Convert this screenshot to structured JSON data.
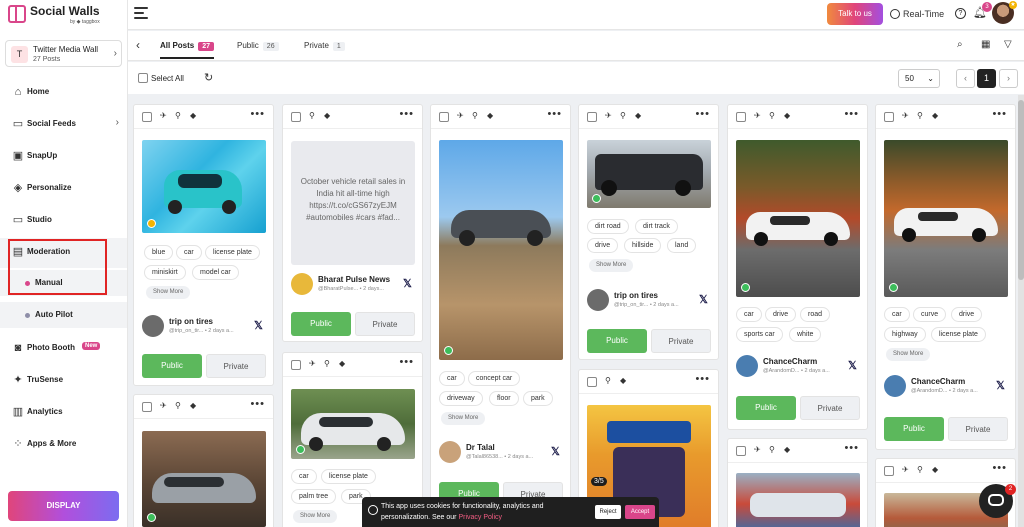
{
  "brand": {
    "name": "Social Walls",
    "by": "by ◆ taggbox"
  },
  "wall": {
    "initial": "T",
    "title": "Twitter Media Wall",
    "posts": "27 Posts"
  },
  "nav": [
    {
      "label": "Home",
      "icon": "home-icon"
    },
    {
      "label": "Social Feeds",
      "icon": "feeds-icon"
    },
    {
      "label": "SnapUp",
      "icon": "snapup-icon"
    },
    {
      "label": "Personalize",
      "icon": "paint-bucket-icon"
    },
    {
      "label": "Studio",
      "icon": "monitor-icon"
    },
    {
      "label": "Moderation",
      "icon": "moderation-icon"
    },
    {
      "label": "Photo Booth",
      "icon": "camera-icon",
      "badge": "New"
    },
    {
      "label": "TruSense",
      "icon": "sparkle-icon"
    },
    {
      "label": "Analytics",
      "icon": "analytics-icon"
    },
    {
      "label": "Apps & More",
      "icon": "apps-icon"
    }
  ],
  "subnav": [
    {
      "label": "Manual",
      "dot_color": "#d9468a"
    },
    {
      "label": "Auto Pilot",
      "dot_color": "#8e8ea8"
    }
  ],
  "display_button": "DISPLAY",
  "topbar": {
    "talk": "Talk to us",
    "realtime": "Real-Time",
    "help": "?",
    "bell_count": "3",
    "star": "★"
  },
  "tabs": [
    {
      "label": "All Posts",
      "count": "27"
    },
    {
      "label": "Public",
      "count": "26"
    },
    {
      "label": "Private",
      "count": "1"
    }
  ],
  "actions": {
    "select_all": "Select All",
    "per_page": "50",
    "page": "1",
    "prev": "‹",
    "next": "›"
  },
  "post_actions": {
    "public": "Public",
    "private": "Private",
    "show_more": "Show More"
  },
  "network_icon": "𝕏",
  "posts": {
    "c1": {
      "tags": [
        "blue",
        "car",
        "license plate",
        "miniskirt",
        "model car"
      ],
      "author": "trip on tires",
      "meta": "@trip_on_tir... • 2 days a..."
    },
    "c2": {
      "text": "October vehicle retail sales in India hit all-time high https://t.co/cGS67zyEJM #automobiles #cars #fad...",
      "author": "Bharat Pulse News",
      "meta": "@BharatPulse... • 2 days..."
    },
    "c3": {
      "tags": [
        "car",
        "concept car",
        "driveway",
        "floor",
        "park"
      ],
      "author": "Dr Talal",
      "meta": "@Talal86538... • 2 days a..."
    },
    "c4": {
      "tags": [
        "dirt road",
        "dirt track",
        "drive",
        "hillside",
        "land"
      ],
      "author": "trip on tires",
      "meta": "@trip_on_tir... • 2 days a..."
    },
    "c5": {
      "tags": [
        "car",
        "drive",
        "road",
        "sports car",
        "white"
      ],
      "author": "ChanceCharm",
      "meta": "@ArandomD... • 2 days a..."
    },
    "c6": {
      "tags": [
        "car",
        "curve",
        "drive",
        "highway",
        "license plate"
      ],
      "author": "ChanceCharm",
      "meta": "@ArandomD... • 2 days a..."
    },
    "c7": {
      "tags": [
        "car",
        "license plate",
        "palm tree",
        "park"
      ]
    },
    "c8": {
      "badge": "3/5"
    }
  },
  "cookie": {
    "text": "This app uses cookies for functionality, analytics and personalization. See our ",
    "link": "Privacy Policy",
    "reject": "Reject",
    "accept": "Accept"
  },
  "chat_count": "2"
}
